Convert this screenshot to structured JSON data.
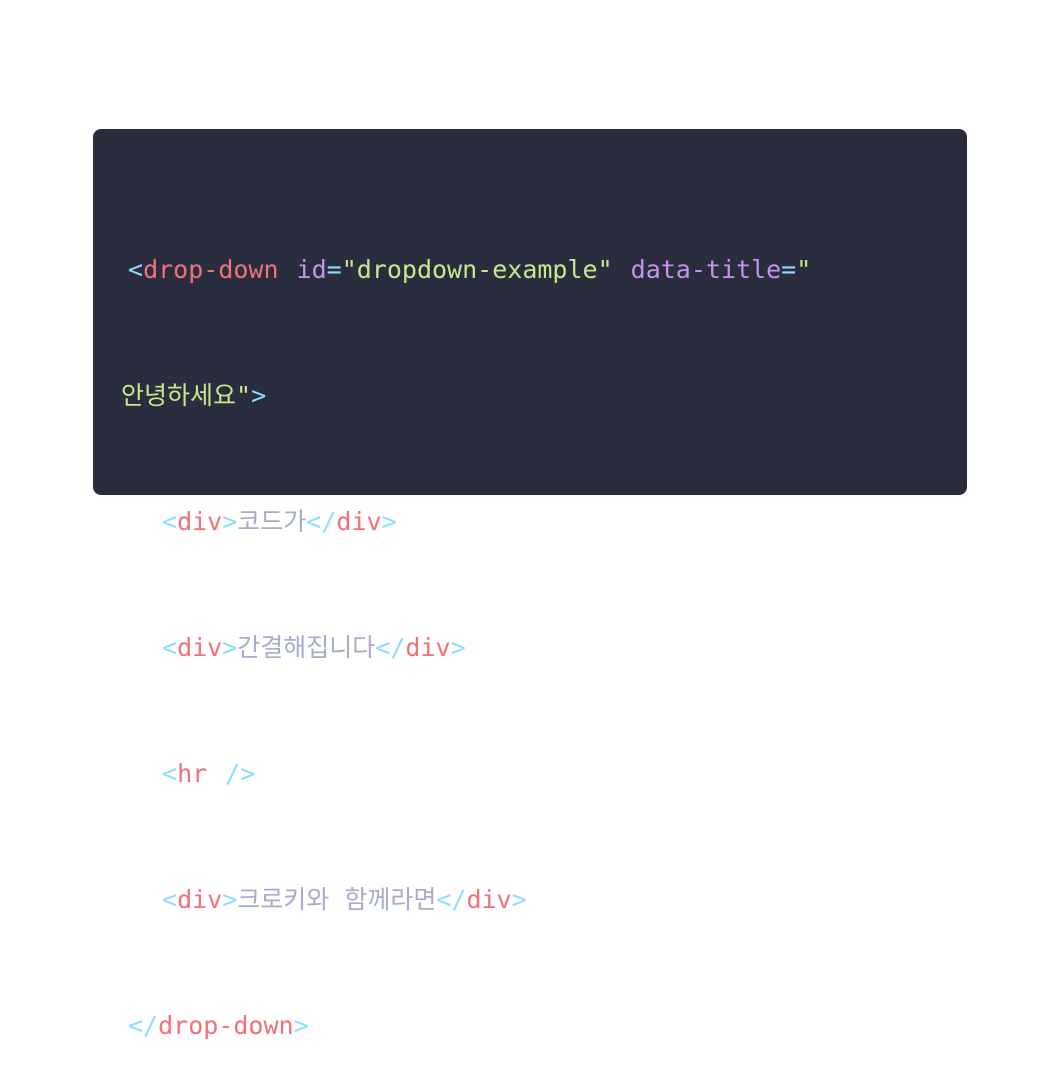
{
  "code": {
    "line1": {
      "open": "<",
      "tag": "drop-down",
      "attr1_name": "id",
      "attr1_eq": "=",
      "attr1_value": "\"dropdown-example\"",
      "attr2_name": "data-title",
      "attr2_eq": "=",
      "attr2_quote_open": "\""
    },
    "line2": {
      "attr2_text": "안녕하세요",
      "attr2_quote_close": "\"",
      "close": ">"
    },
    "line3": {
      "open": "<",
      "tag": "div",
      "close": ">",
      "text": "코드가",
      "end_open": "</",
      "end_tag": "div",
      "end_close": ">"
    },
    "line4": {
      "open": "<",
      "tag": "div",
      "close": ">",
      "text": "간결해집니다",
      "end_open": "</",
      "end_tag": "div",
      "end_close": ">"
    },
    "line5": {
      "open": "<",
      "tag": "hr",
      "self_close": "/>"
    },
    "line6": {
      "open": "<",
      "tag": "div",
      "close": ">",
      "text": "크로키와 함께라면",
      "end_open": "</",
      "end_tag": "div",
      "end_close": ">"
    },
    "line7": {
      "end_open": "</",
      "end_tag": "drop-down",
      "end_close": ">"
    }
  },
  "colors": {
    "background": "#292d3e",
    "punctuation": "#89ddff",
    "tag": "#f07178",
    "attribute": "#c792ea",
    "string": "#c3e88d",
    "text": "#a6accd"
  }
}
